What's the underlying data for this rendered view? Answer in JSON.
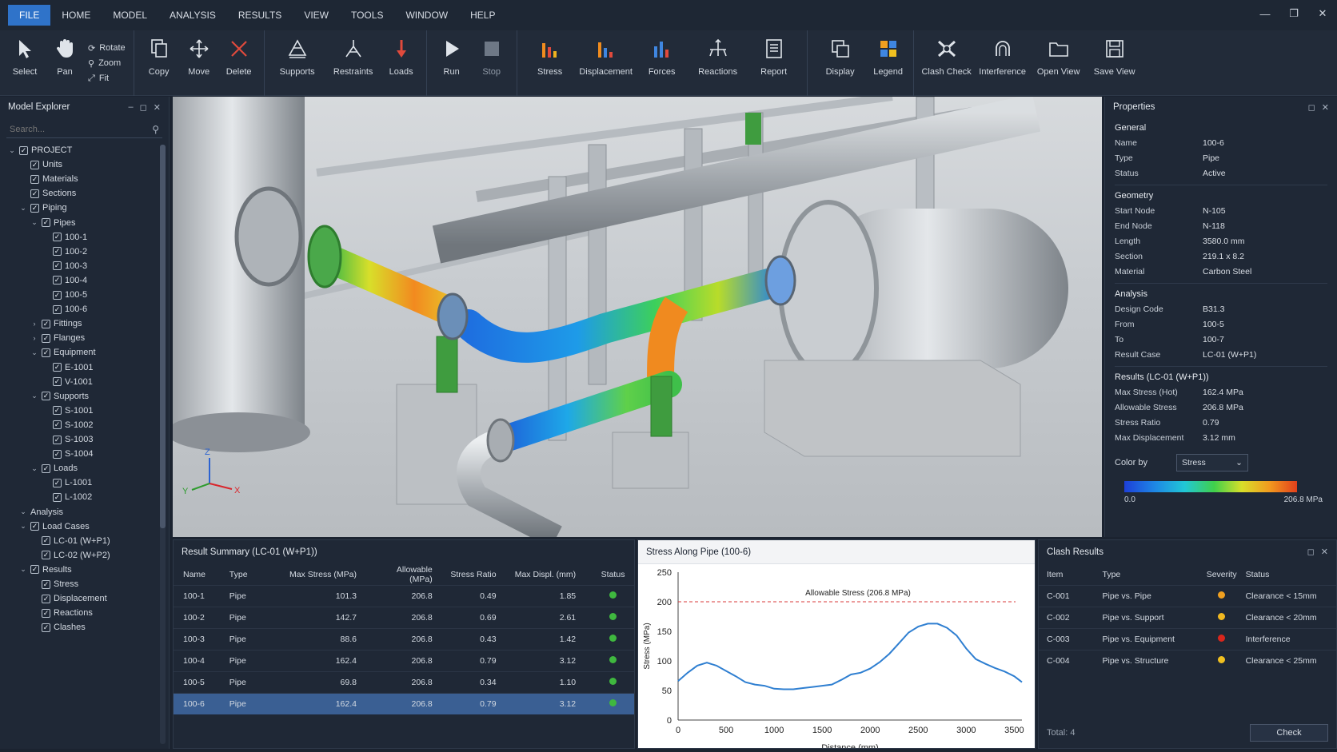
{
  "menu": [
    "FILE",
    "HOME",
    "MODEL",
    "ANALYSIS",
    "RESULTS",
    "VIEW",
    "TOOLS",
    "WINDOW",
    "HELP"
  ],
  "toolbar": {
    "select": "Select",
    "pan": "Pan",
    "rotate": "Rotate",
    "zoom": "Zoom",
    "fit": "Fit",
    "copy": "Copy",
    "move": "Move",
    "delete": "Delete",
    "supports": "Supports",
    "restraints": "Restraints",
    "loads": "Loads",
    "run": "Run",
    "stop": "Stop",
    "stress": "Stress",
    "displacement": "Displacement",
    "forces": "Forces",
    "reactions": "Reactions",
    "report": "Report",
    "display": "Display",
    "legend": "Legend",
    "clash_check": "Clash Check",
    "interference": "Interference",
    "open_view": "Open View",
    "save_view": "Save View"
  },
  "explorer": {
    "title": "Model Explorer",
    "search_placeholder": "Search...",
    "tree": [
      {
        "label": "PROJECT",
        "depth": 0,
        "caret": "open",
        "check": true
      },
      {
        "label": "Units",
        "depth": 1,
        "caret": "",
        "check": true
      },
      {
        "label": "Materials",
        "depth": 1,
        "caret": "",
        "check": true
      },
      {
        "label": "Sections",
        "depth": 1,
        "caret": "",
        "check": true
      },
      {
        "label": "Piping",
        "depth": 1,
        "caret": "open",
        "check": true
      },
      {
        "label": "Pipes",
        "depth": 2,
        "caret": "open",
        "check": true
      },
      {
        "label": "100-1",
        "depth": 3,
        "caret": "",
        "check": true
      },
      {
        "label": "100-2",
        "depth": 3,
        "caret": "",
        "check": true
      },
      {
        "label": "100-3",
        "depth": 3,
        "caret": "",
        "check": true
      },
      {
        "label": "100-4",
        "depth": 3,
        "caret": "",
        "check": true
      },
      {
        "label": "100-5",
        "depth": 3,
        "caret": "",
        "check": true
      },
      {
        "label": "100-6",
        "depth": 3,
        "caret": "",
        "check": true
      },
      {
        "label": "Fittings",
        "depth": 2,
        "caret": "closed",
        "check": true
      },
      {
        "label": "Flanges",
        "depth": 2,
        "caret": "closed",
        "check": true
      },
      {
        "label": "Equipment",
        "depth": 2,
        "caret": "open",
        "check": true
      },
      {
        "label": "E-1001",
        "depth": 3,
        "caret": "",
        "check": true
      },
      {
        "label": "V-1001",
        "depth": 3,
        "caret": "",
        "check": true
      },
      {
        "label": "Supports",
        "depth": 2,
        "caret": "open",
        "check": true
      },
      {
        "label": "S-1001",
        "depth": 3,
        "caret": "",
        "check": true
      },
      {
        "label": "S-1002",
        "depth": 3,
        "caret": "",
        "check": true
      },
      {
        "label": "S-1003",
        "depth": 3,
        "caret": "",
        "check": true
      },
      {
        "label": "S-1004",
        "depth": 3,
        "caret": "",
        "check": true
      },
      {
        "label": "Loads",
        "depth": 2,
        "caret": "open",
        "check": true
      },
      {
        "label": "L-1001",
        "depth": 3,
        "caret": "",
        "check": true
      },
      {
        "label": "L-1002",
        "depth": 3,
        "caret": "",
        "check": true
      },
      {
        "label": "Analysis",
        "depth": 1,
        "caret": "open",
        "check": false
      },
      {
        "label": "Load Cases",
        "depth": 1,
        "caret": "open",
        "check": true
      },
      {
        "label": "LC-01 (W+P1)",
        "depth": 2,
        "caret": "",
        "check": true
      },
      {
        "label": "LC-02 (W+P2)",
        "depth": 2,
        "caret": "",
        "check": true
      },
      {
        "label": "Results",
        "depth": 1,
        "caret": "open",
        "check": true
      },
      {
        "label": "Stress",
        "depth": 2,
        "caret": "",
        "check": true
      },
      {
        "label": "Displacement",
        "depth": 2,
        "caret": "",
        "check": true
      },
      {
        "label": "Reactions",
        "depth": 2,
        "caret": "",
        "check": true
      },
      {
        "label": "Clashes",
        "depth": 2,
        "caret": "",
        "check": true
      }
    ]
  },
  "viewport": {
    "axis_x": "X",
    "axis_y": "Y",
    "axis_z": "Z"
  },
  "properties": {
    "title": "Properties",
    "sections": [
      {
        "title": "General",
        "rows": [
          [
            "Name",
            "100-6"
          ],
          [
            "Type",
            "Pipe"
          ],
          [
            "Status",
            "Active"
          ]
        ]
      },
      {
        "title": "Geometry",
        "rows": [
          [
            "Start Node",
            "N-105"
          ],
          [
            "End Node",
            "N-118"
          ],
          [
            "Length",
            "3580.0 mm"
          ],
          [
            "Section",
            "219.1 x 8.2"
          ],
          [
            "Material",
            "Carbon Steel"
          ]
        ]
      },
      {
        "title": "Analysis",
        "rows": [
          [
            "Design Code",
            "B31.3"
          ],
          [
            "From",
            "100-5"
          ],
          [
            "To",
            "100-7"
          ],
          [
            "Result Case",
            "LC-01 (W+P1)"
          ]
        ]
      },
      {
        "title": "Results (LC-01 (W+P1))",
        "rows": [
          [
            "Max Stress (Hot)",
            "162.4 MPa"
          ],
          [
            "Allowable Stress",
            "206.8 MPa"
          ],
          [
            "Stress Ratio",
            "0.79"
          ],
          [
            "Max Displacement",
            "3.12 mm"
          ]
        ]
      }
    ],
    "color_by_label": "Color by",
    "color_by_value": "Stress",
    "legend_min": "0.0",
    "legend_max": "206.8 MPa"
  },
  "summary": {
    "title": "Result Summary (LC-01 (W+P1))",
    "headers": [
      "Name",
      "Type",
      "Max Stress (MPa)",
      "Allowable (MPa)",
      "Stress Ratio",
      "Max Displ. (mm)",
      "Status"
    ],
    "rows": [
      [
        "100-1",
        "Pipe",
        "101.3",
        "206.8",
        "0.49",
        "1.85"
      ],
      [
        "100-2",
        "Pipe",
        "142.7",
        "206.8",
        "0.69",
        "2.61"
      ],
      [
        "100-3",
        "Pipe",
        "88.6",
        "206.8",
        "0.43",
        "1.42"
      ],
      [
        "100-4",
        "Pipe",
        "162.4",
        "206.8",
        "0.79",
        "3.12"
      ],
      [
        "100-5",
        "Pipe",
        "69.8",
        "206.8",
        "0.34",
        "1.10"
      ],
      [
        "100-6",
        "Pipe",
        "162.4",
        "206.8",
        "0.79",
        "3.12"
      ]
    ],
    "status_color": "#3fb83f",
    "selected_index": 5
  },
  "chart_data": {
    "type": "line",
    "title": "Stress Along Pipe (100-6)",
    "xlabel": "Distance (mm)",
    "ylabel": "Stress (MPa)",
    "xlim": [
      0,
      3580
    ],
    "ylim": [
      0,
      250
    ],
    "xticks": [
      0,
      500,
      1000,
      1500,
      2000,
      2500,
      3000,
      3500
    ],
    "yticks": [
      0,
      50,
      100,
      150,
      200,
      250
    ],
    "grid": false,
    "reference_line": {
      "value": 206.8,
      "label": "Allowable Stress (206.8 MPa)",
      "color": "#d9383a"
    },
    "series": [
      {
        "color": "#2f7fd1",
        "x": [
          0,
          100,
          200,
          300,
          400,
          500,
          600,
          700,
          800,
          900,
          1000,
          1100,
          1200,
          1300,
          1400,
          1500,
          1600,
          1700,
          1800,
          1900,
          2000,
          2100,
          2200,
          2300,
          2400,
          2500,
          2600,
          2700,
          2800,
          2900,
          3000,
          3100,
          3200,
          3300,
          3400,
          3500,
          3580
        ],
        "y": [
          66,
          80,
          92,
          97,
          92,
          83,
          74,
          64,
          60,
          58,
          53,
          52,
          52,
          54,
          56,
          58,
          60,
          68,
          77,
          80,
          87,
          98,
          112,
          130,
          148,
          158,
          163,
          163,
          156,
          143,
          121,
          103,
          95,
          88,
          82,
          74,
          64
        ]
      }
    ]
  },
  "clash": {
    "title": "Clash Results",
    "headers": [
      "Item",
      "Type",
      "Severity",
      "Status"
    ],
    "rows": [
      {
        "item": "C-001",
        "type": "Pipe vs. Pipe",
        "color": "#f0a020",
        "status": "Clearance < 15mm"
      },
      {
        "item": "C-002",
        "type": "Pipe vs. Support",
        "color": "#f0b820",
        "status": "Clearance < 20mm"
      },
      {
        "item": "C-003",
        "type": "Pipe vs. Equipment",
        "color": "#d9261c",
        "status": "Interference"
      },
      {
        "item": "C-004",
        "type": "Pipe vs. Structure",
        "color": "#f0c020",
        "status": "Clearance < 25mm"
      }
    ],
    "total": "Total: 4",
    "check_label": "Check"
  }
}
